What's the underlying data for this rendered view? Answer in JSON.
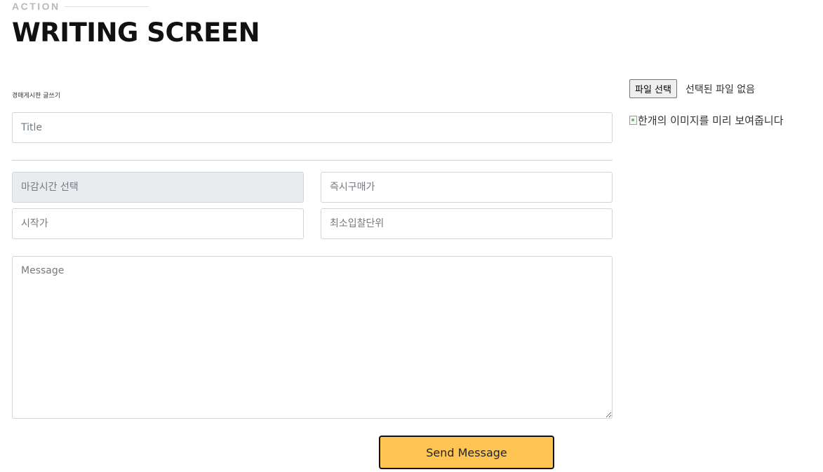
{
  "header": {
    "eyebrow": "ACTION",
    "title": "WRITING SCREEN"
  },
  "form": {
    "label": "경매게시판 글쓰기",
    "title_placeholder": "Title",
    "deadline_placeholder": "마감시간 선택",
    "buy_now_placeholder": "즉시구매가",
    "start_price_placeholder": "시작가",
    "min_bid_placeholder": "최소입찰단위",
    "message_placeholder": "Message",
    "submit_label": "Send Message"
  },
  "upload": {
    "button_label": "파일 선택",
    "status_text": "선택된 파일 없음",
    "preview_alt": "한개의 이미지를 미리 보여줍니다"
  },
  "colors": {
    "accent": "#ffc451",
    "eyebrow": "#b9b9b9",
    "title": "#111111",
    "disabled_bg": "#e9ecef"
  },
  "icons": {
    "broken_image": "broken-image-icon"
  }
}
